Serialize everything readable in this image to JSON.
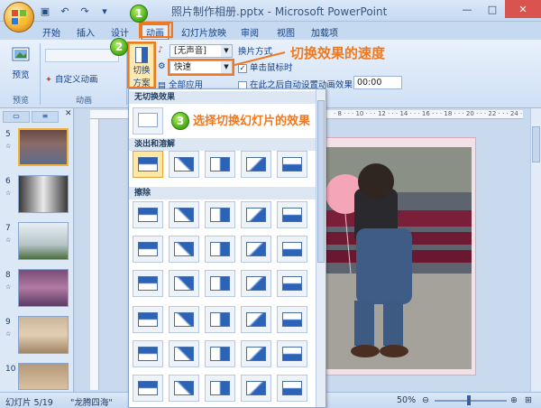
{
  "window": {
    "title": "照片制作相册.pptx - Microsoft PowerPoint"
  },
  "quick_access": [
    "save-icon",
    "undo-icon",
    "redo-icon"
  ],
  "tabs": [
    {
      "label": "开始"
    },
    {
      "label": "插入"
    },
    {
      "label": "设计"
    },
    {
      "label": "动画",
      "active": true
    },
    {
      "label": "幻灯片放映"
    },
    {
      "label": "审阅"
    },
    {
      "label": "视图"
    },
    {
      "label": "加载项"
    }
  ],
  "ribbon": {
    "preview": {
      "button": "预览",
      "group": "预览"
    },
    "animation": {
      "custom": "自定义动画",
      "group": "动画"
    },
    "transition": {
      "scheme_btn_line1": "切换",
      "scheme_btn_line2": "方案",
      "sound_value": "[无声音]",
      "speed_value": "快速",
      "apply_all": "全部应用",
      "advance_title": "换片方式",
      "on_click": "单击鼠标时",
      "auto_after": "在此之后自动设置动画效果:",
      "auto_time": "00:00"
    }
  },
  "annotations": {
    "badge1": "1",
    "badge2": "2",
    "badge3": "3",
    "speed_callout": "切换效果的速度",
    "gallery_callout": "选择切换幻灯片的效果"
  },
  "gallery": {
    "section_none": "无切换效果",
    "section_fade": "淡出和溶解",
    "section_wipe": "擦除"
  },
  "slides": [
    {
      "num": "5",
      "selected": true
    },
    {
      "num": "6"
    },
    {
      "num": "7"
    },
    {
      "num": "8"
    },
    {
      "num": "9"
    },
    {
      "num": "10"
    }
  ],
  "ruler_text": "· 8 · · · 10 · · · 12 · · · 14 · · · 16 · · · 18 · · · 20 · · · 22 · · · 24 ·",
  "status": {
    "slide": "幻灯片 5/19",
    "theme": "\"龙腾四海\"",
    "zoom": "50%"
  },
  "colors": {
    "accent": "#f07820",
    "ribbon": "#cfe0f5",
    "badge": "#46a814"
  }
}
